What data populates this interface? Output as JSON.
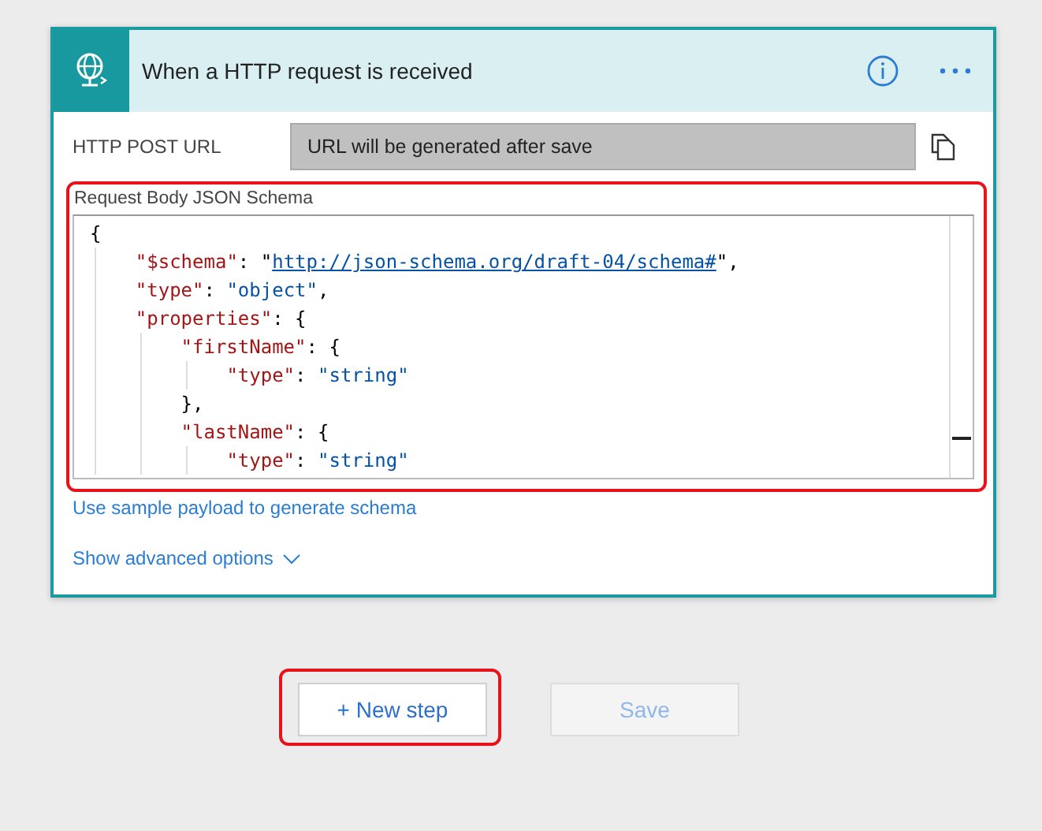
{
  "trigger": {
    "title": "When a HTTP request is received",
    "url_field": {
      "label": "HTTP POST URL",
      "value": "URL will be generated after save"
    },
    "schema": {
      "label": "Request Body JSON Schema",
      "lines": [
        {
          "tokens": [
            {
              "kind": "punct",
              "text": "{"
            }
          ],
          "children": [
            {
              "tokens": [
                {
                  "kind": "key",
                  "text": "\"$schema\""
                },
                {
                  "kind": "punct",
                  "text": ": \""
                },
                {
                  "kind": "link",
                  "text": "http://json-schema.org/draft-04/schema#"
                },
                {
                  "kind": "punct",
                  "text": "\","
                }
              ]
            },
            {
              "tokens": [
                {
                  "kind": "key",
                  "text": "\"type\""
                },
                {
                  "kind": "punct",
                  "text": ": "
                },
                {
                  "kind": "string",
                  "text": "\"object\""
                },
                {
                  "kind": "punct",
                  "text": ","
                }
              ]
            },
            {
              "tokens": [
                {
                  "kind": "key",
                  "text": "\"properties\""
                },
                {
                  "kind": "punct",
                  "text": ": {"
                }
              ],
              "children": [
                {
                  "tokens": [
                    {
                      "kind": "key",
                      "text": "\"firstName\""
                    },
                    {
                      "kind": "punct",
                      "text": ": {"
                    }
                  ],
                  "children": [
                    {
                      "tokens": [
                        {
                          "kind": "key",
                          "text": "\"type\""
                        },
                        {
                          "kind": "punct",
                          "text": ": "
                        },
                        {
                          "kind": "string",
                          "text": "\"string\""
                        }
                      ]
                    }
                  ]
                },
                {
                  "tokens": [
                    {
                      "kind": "punct",
                      "text": "},"
                    }
                  ]
                },
                {
                  "tokens": [
                    {
                      "kind": "key",
                      "text": "\"lastName\""
                    },
                    {
                      "kind": "punct",
                      "text": ": {"
                    }
                  ],
                  "children": [
                    {
                      "tokens": [
                        {
                          "kind": "key",
                          "text": "\"type\""
                        },
                        {
                          "kind": "punct",
                          "text": ": "
                        },
                        {
                          "kind": "string",
                          "text": "\"string\""
                        }
                      ]
                    }
                  ]
                }
              ]
            }
          ]
        }
      ],
      "highlighted": true
    },
    "sample_link": "Use sample payload to generate schema",
    "advanced": "Show advanced options"
  },
  "buttons": [
    {
      "label": "+ New step",
      "disabled": false,
      "highlighted": true
    },
    {
      "label": "Save",
      "disabled": true,
      "highlighted": false
    }
  ]
}
